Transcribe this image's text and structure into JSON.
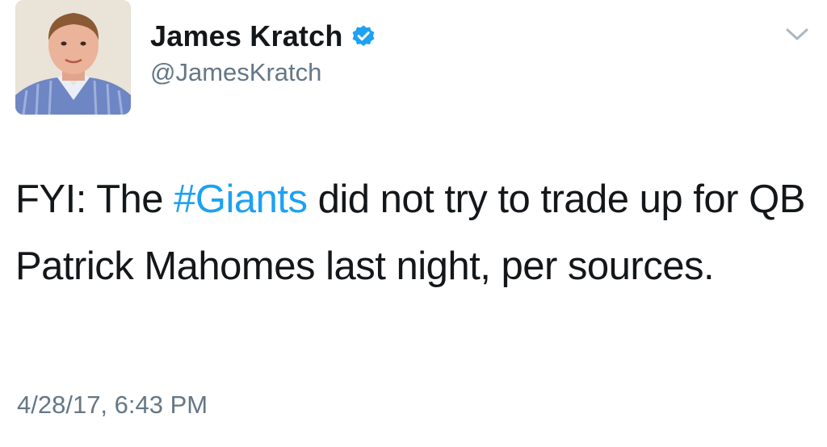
{
  "author": {
    "display_name": "James Kratch",
    "handle": "@JamesKratch",
    "verified": true,
    "avatar_icon": "profile-photo"
  },
  "tweet": {
    "text_before": "FYI: The ",
    "hashtag": "#Giants",
    "text_after": " did not try to trade up for QB Patrick Mahomes last night, per sources.",
    "timestamp": "4/28/17, 6:43 PM"
  },
  "icons": {
    "menu": "chevron-down-icon",
    "verified": "verified-badge-icon"
  },
  "colors": {
    "hashtag": "#1da1f2",
    "verified_badge": "#1da1f2",
    "secondary_text": "#657786",
    "primary_text": "#14171a"
  }
}
